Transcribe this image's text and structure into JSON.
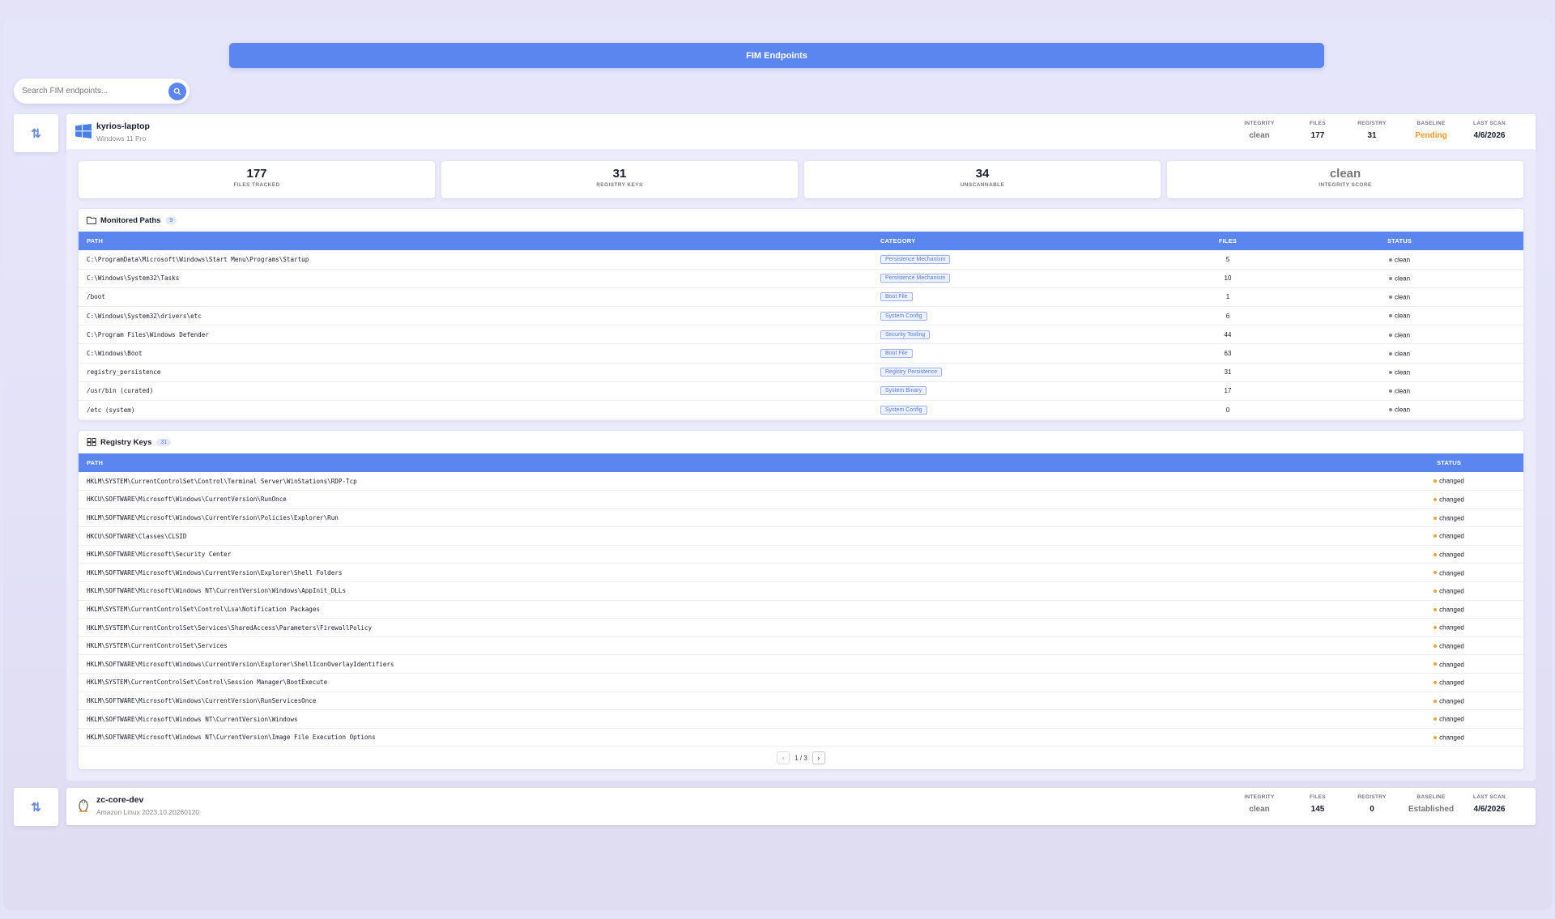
{
  "title": "FIM Endpoints",
  "search": {
    "placeholder": "Search FIM endpoints..."
  },
  "endpoints": [
    {
      "name": "kyrios-laptop",
      "os": "Windows 11 Pro",
      "os_icon": "windows-icon",
      "stats": {
        "integrity_label": "INTEGRITY",
        "integrity": "clean",
        "files_label": "FILES",
        "files": "177",
        "registry_label": "REGISTRY",
        "registry": "31",
        "baseline_label": "BASELINE",
        "baseline": "Pending",
        "last_scan_label": "LAST SCAN",
        "last_scan": "4/6/2026"
      }
    },
    {
      "name": "zc-core-dev",
      "os": "Amazon Linux 2023.10.20260120",
      "os_icon": "linux-penguin-icon",
      "stats": {
        "integrity_label": "INTEGRITY",
        "integrity": "clean",
        "files_label": "FILES",
        "files": "145",
        "registry_label": "REGISTRY",
        "registry": "0",
        "baseline_label": "BASELINE",
        "baseline": "Established",
        "last_scan_label": "LAST SCAN",
        "last_scan": "4/6/2026"
      }
    }
  ],
  "summary": [
    {
      "value": "177",
      "caption": "FILES TRACKED"
    },
    {
      "value": "31",
      "caption": "REGISTRY KEYS"
    },
    {
      "value": "34",
      "caption": "UNSCANNABLE"
    },
    {
      "value": "clean",
      "caption": "INTEGRITY SCORE"
    }
  ],
  "monitored": {
    "title": "Monitored Paths",
    "count": "9",
    "columns": {
      "path": "PATH",
      "category": "CATEGORY",
      "files": "FILES",
      "status": "STATUS"
    },
    "rows": [
      {
        "path": "C:\\ProgramData\\Microsoft\\Windows\\Start Menu\\Programs\\Startup",
        "category": "Persistence Mechanism",
        "files": "5",
        "status": "clean"
      },
      {
        "path": "C:\\Windows\\System32\\Tasks",
        "category": "Persistence Mechanism",
        "files": "10",
        "status": "clean"
      },
      {
        "path": "/boot",
        "category": "Boot File",
        "files": "1",
        "status": "clean"
      },
      {
        "path": "C:\\Windows\\System32\\drivers\\etc",
        "category": "System Config",
        "files": "6",
        "status": "clean"
      },
      {
        "path": "C:\\Program Files\\Windows Defender",
        "category": "Security Tooling",
        "files": "44",
        "status": "clean"
      },
      {
        "path": "C:\\Windows\\Boot",
        "category": "Boot File",
        "files": "63",
        "status": "clean"
      },
      {
        "path": "registry_persistence",
        "category": "Registry Persistence",
        "files": "31",
        "status": "clean"
      },
      {
        "path": "/usr/bin (curated)",
        "category": "System Binary",
        "files": "17",
        "status": "clean"
      },
      {
        "path": "/etc (system)",
        "category": "System Config",
        "files": "0",
        "status": "clean"
      }
    ]
  },
  "registry": {
    "title": "Registry Keys",
    "count": "31",
    "columns": {
      "path": "PATH",
      "status": "STATUS"
    },
    "rows": [
      {
        "path": "HKLM\\SYSTEM\\CurrentControlSet\\Control\\Terminal Server\\WinStations\\RDP-Tcp",
        "status": "changed"
      },
      {
        "path": "HKCU\\SOFTWARE\\Microsoft\\Windows\\CurrentVersion\\RunOnce",
        "status": "changed"
      },
      {
        "path": "HKLM\\SOFTWARE\\Microsoft\\Windows\\CurrentVersion\\Policies\\Explorer\\Run",
        "status": "changed"
      },
      {
        "path": "HKCU\\SOFTWARE\\Classes\\CLSID",
        "status": "changed"
      },
      {
        "path": "HKLM\\SOFTWARE\\Microsoft\\Security Center",
        "status": "changed"
      },
      {
        "path": "HKLM\\SOFTWARE\\Microsoft\\Windows\\CurrentVersion\\Explorer\\Shell Folders",
        "status": "changed"
      },
      {
        "path": "HKLM\\SOFTWARE\\Microsoft\\Windows NT\\CurrentVersion\\Windows\\AppInit_DLLs",
        "status": "changed"
      },
      {
        "path": "HKLM\\SYSTEM\\CurrentControlSet\\Control\\Lsa\\Notification Packages",
        "status": "changed"
      },
      {
        "path": "HKLM\\SYSTEM\\CurrentControlSet\\Services\\SharedAccess\\Parameters\\FirewallPolicy",
        "status": "changed"
      },
      {
        "path": "HKLM\\SYSTEM\\CurrentControlSet\\Services",
        "status": "changed"
      },
      {
        "path": "HKLM\\SOFTWARE\\Microsoft\\Windows\\CurrentVersion\\Explorer\\ShellIconOverlayIdentifiers",
        "status": "changed"
      },
      {
        "path": "HKLM\\SYSTEM\\CurrentControlSet\\Control\\Session Manager\\BootExecute",
        "status": "changed"
      },
      {
        "path": "HKLM\\SOFTWARE\\Microsoft\\Windows\\CurrentVersion\\RunServicesOnce",
        "status": "changed"
      },
      {
        "path": "HKLM\\SOFTWARE\\Microsoft\\Windows NT\\CurrentVersion\\Windows",
        "status": "changed"
      },
      {
        "path": "HKLM\\SOFTWARE\\Microsoft\\Windows NT\\CurrentVersion\\Image File Execution Options",
        "status": "changed"
      }
    ],
    "pagination": {
      "label": "1 / 3"
    }
  },
  "colors": {
    "accent": "#5b86f0",
    "pending": "#e99a2e",
    "changed": "#e9a23b",
    "clean": "#888888"
  }
}
